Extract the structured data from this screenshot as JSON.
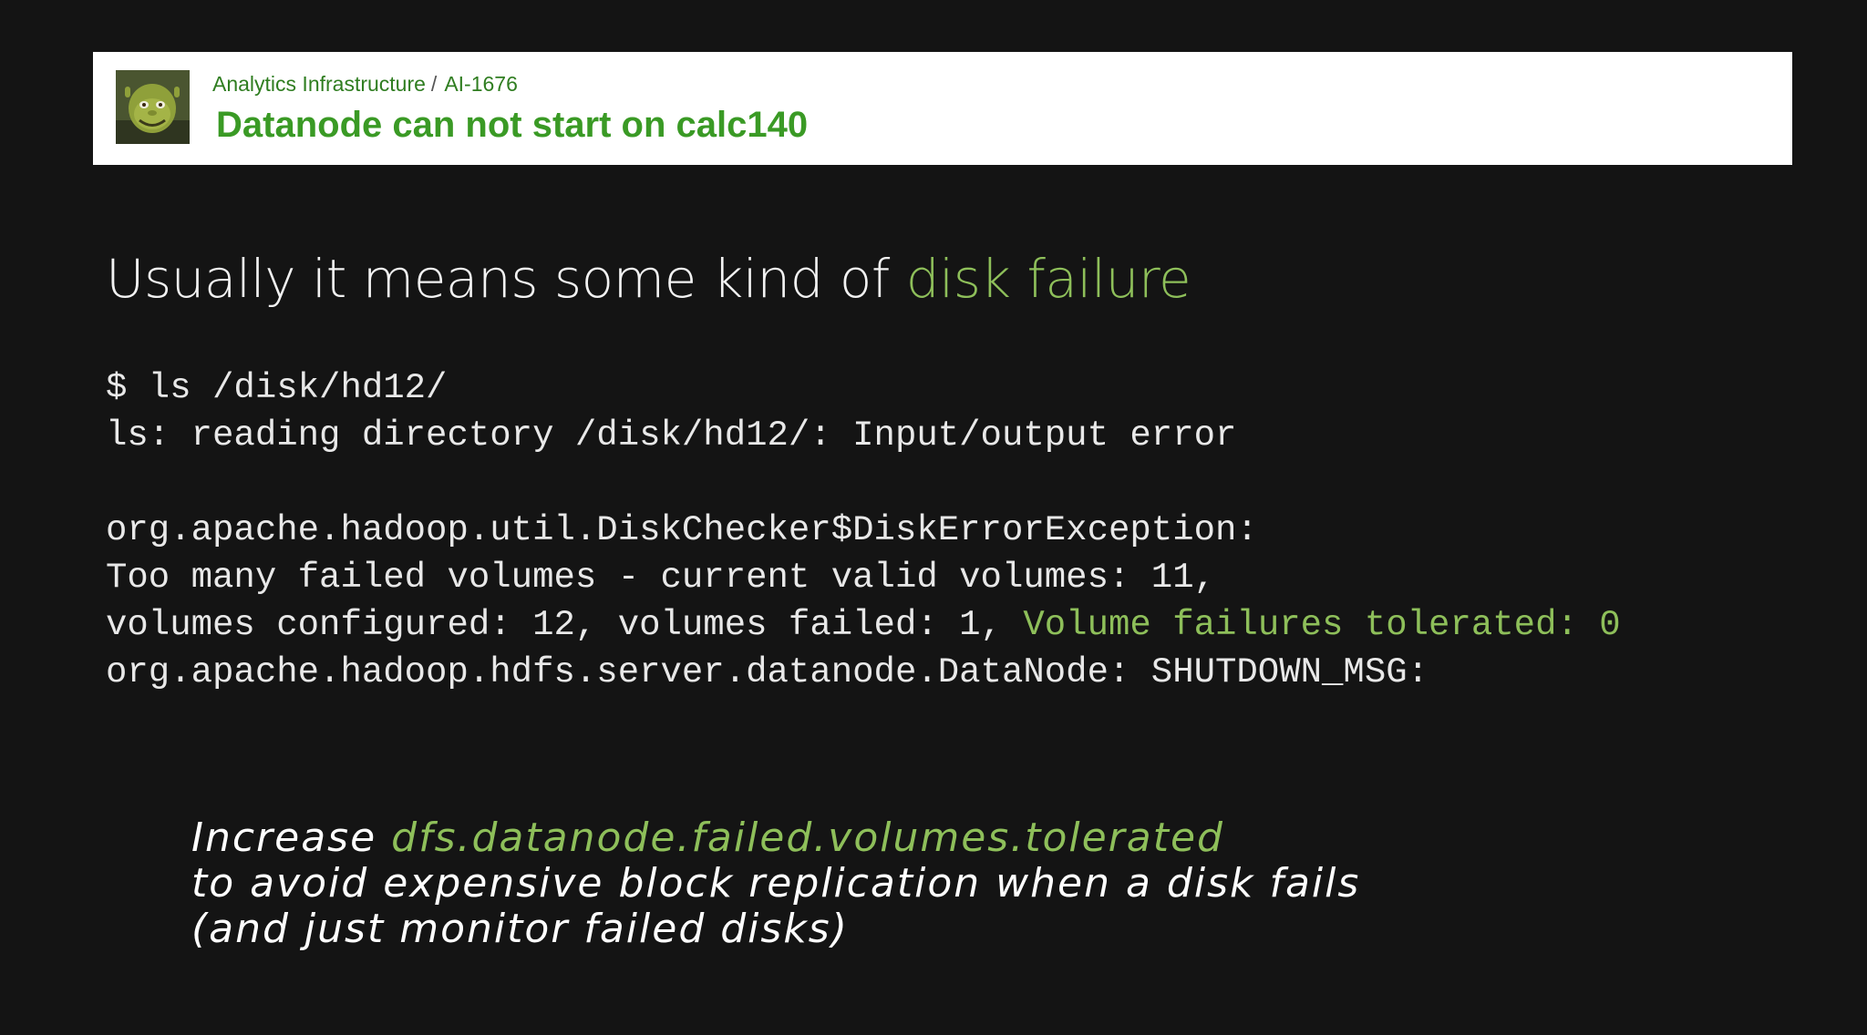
{
  "issue": {
    "project": "Analytics Infrastructure",
    "separator": "/",
    "key": "AI-1676",
    "title": "Datanode can not start on calc140",
    "avatar_icon": "shrek-avatar-icon"
  },
  "headline": {
    "text": "Usually it means some kind of ",
    "accent": "disk failure"
  },
  "terminal": {
    "line1": "$ ls /disk/hd12/",
    "line2": "ls: reading directory /disk/hd12/: Input/output error",
    "line3": "org.apache.hadoop.util.DiskChecker$DiskErrorException:",
    "line4": "Too many failed volumes - current valid volumes: 11,",
    "line5_prefix": "volumes configured: 12, volumes failed: 1, ",
    "line5_accent": "Volume failures tolerated: 0",
    "line6": "org.apache.hadoop.hdfs.server.datanode.DataNode: SHUTDOWN_MSG:"
  },
  "note": {
    "line1_prefix": "Increase ",
    "line1_accent": "dfs.datanode.failed.volumes.tolerated",
    "line2": "to avoid expensive block replication when a disk fails",
    "line3": "(and just monitor failed disks)"
  },
  "colors": {
    "background": "#141414",
    "accent_green": "#8ebf5a",
    "title_green": "#3a9a25",
    "text": "#f2f2f2"
  }
}
